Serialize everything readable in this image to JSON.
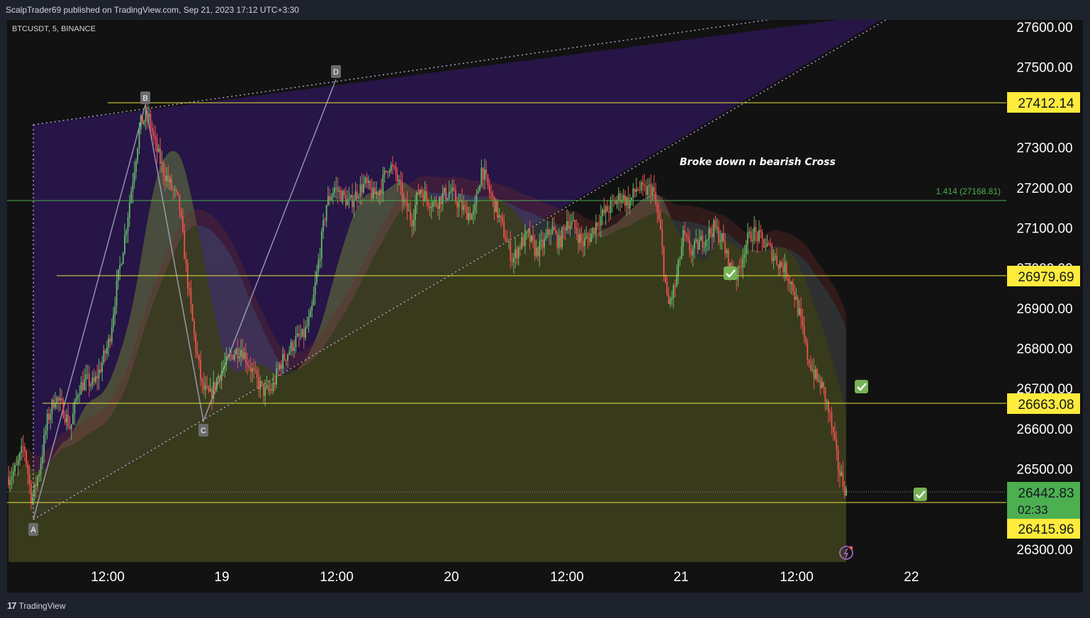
{
  "header": {
    "published": "ScalpTrader69 published on TradingView.com, Sep 21, 2023 17:12 UTC+3:30"
  },
  "symbol": {
    "label": "BTCUSDT, 5, BINANCE"
  },
  "footer": {
    "brand": "TradingView",
    "logo_glyph": "17"
  },
  "colors": {
    "background": "#121212",
    "frame": "#1e222d",
    "text": "#d1d4dc",
    "level_line": "#e8e43a",
    "fib_line": "#4caf50",
    "up_candle": "#66bb6a",
    "down_candle": "#ef5350",
    "wedge_fill": "#2a1650",
    "current_price_badge": "#4caf50"
  },
  "chart_data": {
    "type": "candlestick",
    "instrument": "BTCUSDT, 5, BINANCE",
    "ylim": [
      26270,
      27640
    ],
    "y_ticks": [
      "27600.00",
      "27500.00",
      "27400.00",
      "27300.00",
      "27200.00",
      "27100.00",
      "27000.00",
      "26900.00",
      "26800.00",
      "26700.00",
      "26600.00",
      "26500.00",
      "26300.00"
    ],
    "x_ticks": [
      "12:00",
      "19",
      "12:00",
      "20",
      "12:00",
      "21",
      "12:00",
      "22"
    ],
    "horizontal_levels": [
      {
        "value": 27412.14,
        "label": "27412.14"
      },
      {
        "value": 26979.69,
        "label": "26979.69"
      },
      {
        "value": 26663.08,
        "label": "26663.08"
      },
      {
        "value": 26415.96,
        "label": "26415.96"
      }
    ],
    "fib_level": {
      "value": 27168.81,
      "label": "1.414 (27168.81)"
    },
    "current_price": {
      "value": 26442.83,
      "label": "26442.83",
      "countdown": "02:33"
    },
    "pattern_points": [
      {
        "label": "A",
        "value": 26410
      },
      {
        "label": "B",
        "value": 27400
      },
      {
        "label": "C",
        "value": 26620
      },
      {
        "label": "D",
        "value": 27465
      }
    ],
    "annotation": "Broke down n bearish Cross",
    "price_path": [
      26480,
      26500,
      26560,
      26420,
      26500,
      26620,
      26680,
      26650,
      26600,
      26700,
      26720,
      26710,
      26760,
      26820,
      26960,
      27080,
      27220,
      27360,
      27380,
      27300,
      27240,
      27200,
      27160,
      26980,
      26820,
      26700,
      26680,
      26730,
      26760,
      26790,
      26800,
      26760,
      26720,
      26690,
      26700,
      26760,
      26790,
      26820,
      26830,
      26880,
      27020,
      27160,
      27200,
      27180,
      27160,
      27190,
      27210,
      27180,
      27200,
      27260,
      27230,
      27160,
      27120,
      27200,
      27170,
      27160,
      27180,
      27190,
      27160,
      27140,
      27130,
      27250,
      27190,
      27140,
      27080,
      27020,
      27060,
      27080,
      27040,
      27060,
      27100,
      27060,
      27120,
      27100,
      27060,
      27080,
      27120,
      27140,
      27160,
      27180,
      27160,
      27200,
      27190,
      27200,
      27100,
      26900,
      26960,
      27080,
      27040,
      27060,
      27080,
      27100,
      27070,
      27000,
      26980,
      27060,
      27090,
      27070,
      27050,
      27020,
      27000,
      26960,
      26880,
      26780,
      26730,
      26700,
      26620,
      26500,
      26442
    ]
  }
}
